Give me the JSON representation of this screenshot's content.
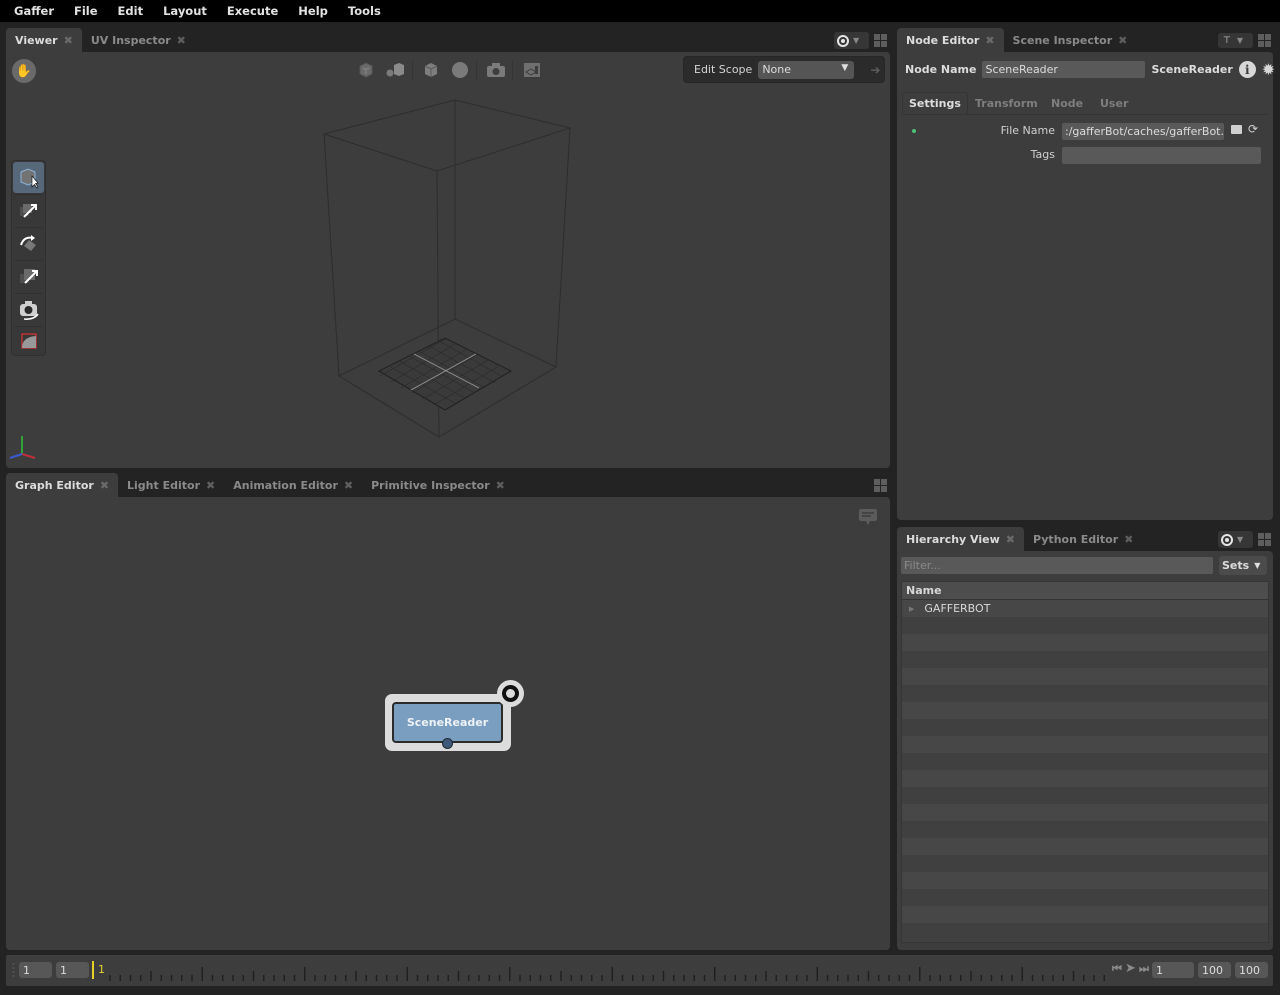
{
  "menubar": [
    "Gaffer",
    "File",
    "Edit",
    "Layout",
    "Execute",
    "Help",
    "Tools"
  ],
  "viewer_panel": {
    "tabs": [
      {
        "label": "Viewer",
        "active": true
      },
      {
        "label": "UV Inspector",
        "active": false
      }
    ],
    "toolbar_icons": [
      "selection-mask-icon",
      "expansion-icon",
      "drawing-mode-icon",
      "shading-mode-icon",
      "camera-icon",
      "grid-gnomon-icon"
    ],
    "edit_scope": {
      "label": "Edit Scope",
      "value": "None"
    },
    "tools": [
      {
        "name": "selection-tool",
        "selected": true
      },
      {
        "name": "translate-tool",
        "selected": false
      },
      {
        "name": "rotate-tool",
        "selected": false
      },
      {
        "name": "scale-tool",
        "selected": false
      },
      {
        "name": "camera-tool",
        "selected": false
      },
      {
        "name": "crop-window-tool",
        "selected": false
      }
    ]
  },
  "graph_panel": {
    "tabs": [
      {
        "label": "Graph Editor",
        "active": true
      },
      {
        "label": "Light Editor",
        "active": false
      },
      {
        "label": "Animation Editor",
        "active": false
      },
      {
        "label": "Primitive Inspector",
        "active": false
      }
    ],
    "node": {
      "label": "SceneReader",
      "color": "#7a9ebf"
    }
  },
  "node_editor": {
    "tabs": [
      {
        "label": "Node Editor",
        "active": true
      },
      {
        "label": "Scene Inspector",
        "active": false
      }
    ],
    "node_name_label": "Node Name",
    "node_name_value": "SceneReader",
    "node_type": "SceneReader",
    "subtabs": [
      "Settings",
      "Transform",
      "Node",
      "User"
    ],
    "active_subtab": "Settings",
    "plugs": [
      {
        "label": "File Name",
        "value": ":/gafferBot/caches/gafferBot.scc"
      },
      {
        "label": "Tags",
        "value": ""
      }
    ]
  },
  "hierarchy_panel": {
    "tabs": [
      {
        "label": "Hierarchy View",
        "active": true
      },
      {
        "label": "Python Editor",
        "active": false
      }
    ],
    "filter_placeholder": "Filter...",
    "sets_label": "Sets",
    "column_header": "Name",
    "rows": [
      {
        "label": "GAFFERBOT",
        "expandable": true
      }
    ]
  },
  "timeline": {
    "start": "1",
    "range_start": "1",
    "current_frame": "1",
    "frame": "1",
    "range_end": "100",
    "end": "100",
    "playhead_color": "#e3d22b"
  }
}
